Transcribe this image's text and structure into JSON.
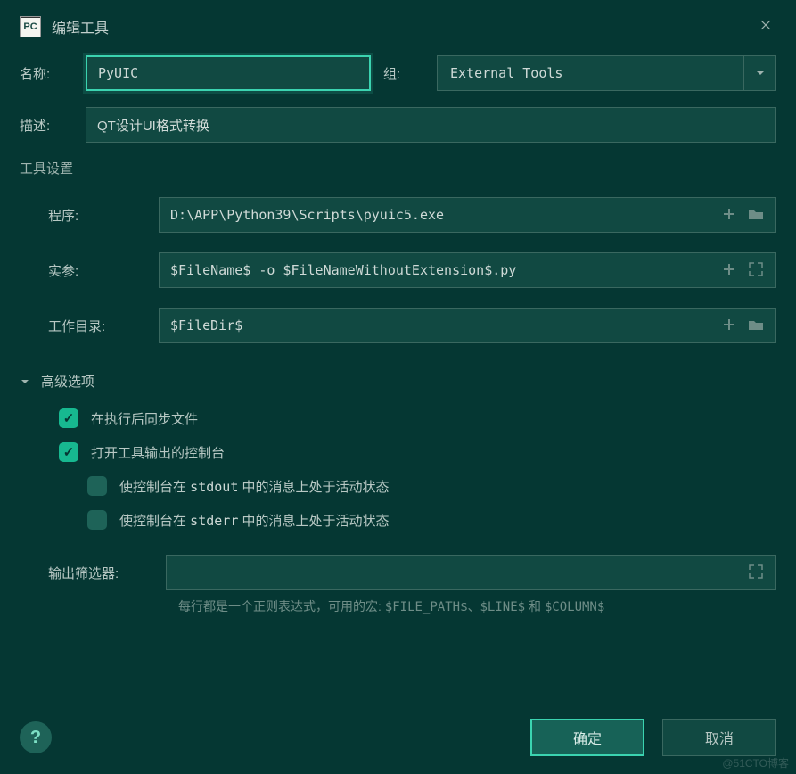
{
  "window": {
    "title": "编辑工具"
  },
  "form": {
    "name_label": "名称:",
    "name_value": "PyUIC",
    "group_label": "组:",
    "group_value": "External Tools",
    "desc_label": "描述:",
    "desc_value": "QT设计UI格式转换"
  },
  "settings": {
    "section_title": "工具设置",
    "program_label": "程序:",
    "program_value": "D:\\APP\\Python39\\Scripts\\pyuic5.exe",
    "args_label": "实参:",
    "args_value": "$FileName$ -o $FileNameWithoutExtension$.py",
    "workdir_label": "工作目录:",
    "workdir_value": "$FileDir$"
  },
  "advanced": {
    "title": "高级选项",
    "sync_label": "在执行后同步文件",
    "console_label": "打开工具输出的控制台",
    "stdout_prefix": "使控制台在 ",
    "stdout_code": "stdout",
    "stdout_suffix": " 中的消息上处于活动状态",
    "stderr_prefix": "使控制台在 ",
    "stderr_code": "stderr",
    "stderr_suffix": " 中的消息上处于活动状态",
    "filter_label": "输出筛选器:",
    "filter_value": "",
    "hint_prefix": "每行都是一个正则表达式，可用的宏: ",
    "hint_m1": "$FILE_PATH$",
    "hint_sep1": "、",
    "hint_m2": "$LINE$",
    "hint_sep2": " 和 ",
    "hint_m3": "$COLUMN$"
  },
  "footer": {
    "ok": "确定",
    "cancel": "取消",
    "help": "?"
  },
  "watermark": "@51CTO博客"
}
